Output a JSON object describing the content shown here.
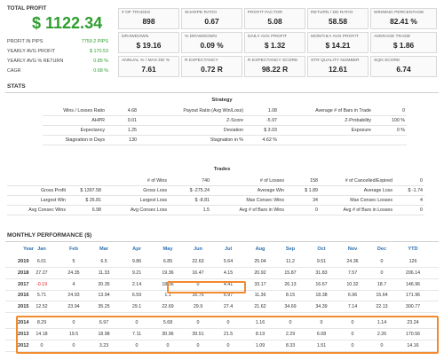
{
  "summary": {
    "total_profit_label": "TOTAL PROFIT",
    "total_profit_value": "$ 1122.34",
    "rows": [
      {
        "label": "PROFIT IN PIPS",
        "value": "7759.2 PIPS"
      },
      {
        "label": "YEARLY AVG PROFIT",
        "value": "$ 170.53"
      },
      {
        "label": "YEARLY AVG % RETURN",
        "value": "0.85 %"
      },
      {
        "label": "CAGR",
        "value": "0.68 %"
      }
    ]
  },
  "metrics": [
    {
      "label": "# OF TRADES",
      "value": "898"
    },
    {
      "label": "SHARPE RATIO",
      "value": "0.67"
    },
    {
      "label": "PROFIT FACTOR",
      "value": "5.08"
    },
    {
      "label": "RETURN / DD RATIO",
      "value": "58.58"
    },
    {
      "label": "WINNING PERCENTAGE",
      "value": "82.41 %"
    },
    {
      "label": "DRAWDOWN",
      "value": "$ 19.16"
    },
    {
      "label": "% DRAWDOWN",
      "value": "0.09 %"
    },
    {
      "label": "DAILY AVG PROFIT",
      "value": "$ 1.32"
    },
    {
      "label": "MONTHLY AVG PROFIT",
      "value": "$ 14.21"
    },
    {
      "label": "AVERAGE TRADE",
      "value": "$ 1.86"
    },
    {
      "label": "ANNUAL % / MAX DD %",
      "value": "7.61"
    },
    {
      "label": "R EXPECTANCY",
      "value": "0.72 R"
    },
    {
      "label": "R EXPECTANCY SCORE",
      "value": "98.22 R"
    },
    {
      "label": "STR QUALITY NUMBER",
      "value": "12.61"
    },
    {
      "label": "SQN SCORE",
      "value": "6.74"
    }
  ],
  "stats_title": "STATS",
  "strategy": {
    "title": "Strategy",
    "rows": [
      [
        "Wins / Losses Ratio",
        "4.68",
        "Payout Ratio (Avg Win/Loss)",
        "1.08",
        "Average # of Bars in Trade",
        "0"
      ],
      [
        "AHPR",
        "0.01",
        "Z-Score",
        "-5.97",
        "Z-Probability",
        "100 %"
      ],
      [
        "Expectancy",
        "1.25",
        "Deviation",
        "$ 3.03",
        "Exposure",
        "0 %"
      ],
      [
        "Stagnation in Days",
        "130",
        "Stagnation in %",
        "4.62 %",
        "",
        ""
      ]
    ]
  },
  "trades": {
    "title": "Trades",
    "rows": [
      [
        "",
        "",
        "# of Wins",
        "740",
        "# of Losses",
        "158",
        "# of Cancelled/Expired",
        "0"
      ],
      [
        "Gross Profit",
        "$ 1397.58",
        "Gross Loss",
        "$ -275.24",
        "Average Win",
        "$ 1.89",
        "Average Loss",
        "$ -1.74"
      ],
      [
        "Largest Win",
        "$ 26.81",
        "Largest Loss",
        "$ -8.81",
        "Max Consec Wins",
        "34",
        "Max Consec Losses",
        "4"
      ],
      [
        "Avg Consec Wins",
        "6.98",
        "Avg Consec Loss",
        "1.5",
        "Avg # of Bars in Wins",
        "0",
        "Avg # of Bars in Losses",
        "0"
      ]
    ]
  },
  "monthly": {
    "title": "MONTHLY PERFORMANCE ($)",
    "headers": [
      "Year",
      "Jan",
      "Feb",
      "Mar",
      "Apr",
      "May",
      "Jun",
      "Jul",
      "Aug",
      "Sep",
      "Oct",
      "Nov",
      "Dec",
      "YTD"
    ],
    "rows": [
      [
        "2019",
        "6.01",
        "5",
        "6.5",
        "9.86",
        "6.85",
        "22.63",
        "5.64",
        "25.04",
        "11.2",
        "9.51",
        "24.36",
        "0",
        "126"
      ],
      [
        "2018",
        "27.27",
        "24.35",
        "11.33",
        "9.21",
        "19.36",
        "16.47",
        "4.15",
        "20.92",
        "15.87",
        "31.83",
        "7.57",
        "0",
        "206.14"
      ],
      [
        "2017",
        "-0.19",
        "4",
        "20.35",
        "2.14",
        "18.36",
        "0",
        "4.41",
        "33.17",
        "26.13",
        "16.67",
        "10.32",
        "18.7",
        "146.96"
      ],
      [
        "2016",
        "5.71",
        "24.93",
        "13.94",
        "6.59",
        "1.1",
        "16.75",
        "6.97",
        "11.36",
        "8.15",
        "18.38",
        "6.96",
        "15.64",
        "171.96"
      ],
      [
        "2015",
        "12.52",
        "23.94",
        "35.25",
        "29.1",
        "22.69",
        "29.9",
        "27.4",
        "21.62",
        "34.69",
        "34.39",
        "7.14",
        "22.13",
        "300.77"
      ],
      [
        "2014",
        "8.29",
        "0",
        "6.97",
        "0",
        "5.68",
        "0",
        "0",
        "1.16",
        "0",
        "0",
        "0",
        "1.14",
        "23.24"
      ],
      [
        "2013",
        "14.18",
        "19.5",
        "18.98",
        "7.11",
        "30.96",
        "39.51",
        "21.5",
        "8.19",
        "2.29",
        "6.08",
        "0",
        "2.26",
        "170.56"
      ],
      [
        "2012",
        "0",
        "0",
        "3.23",
        "0",
        "0",
        "0",
        "0",
        "1.09",
        "8.33",
        "1.51",
        "0",
        "0",
        "14.16"
      ]
    ]
  },
  "colors": {
    "accent_green": "#2e9e2e",
    "negative_red": "#e02020",
    "highlight_orange": "#f28a2e",
    "month_header_blue": "#2a6fb0"
  }
}
